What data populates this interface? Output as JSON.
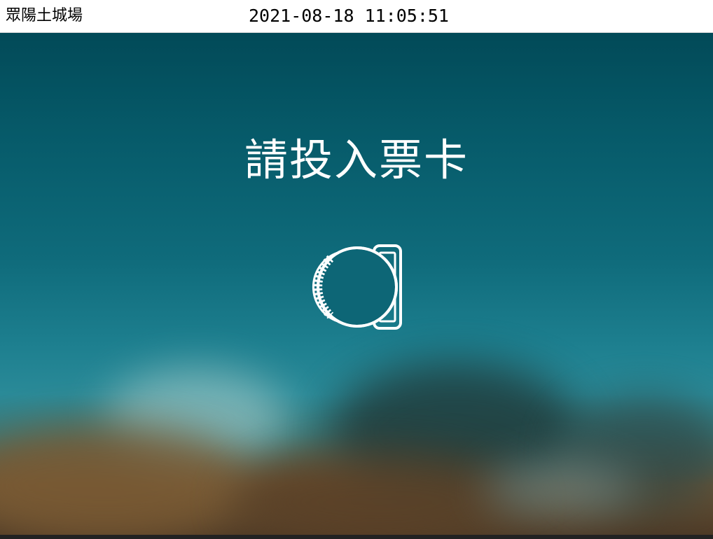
{
  "header": {
    "station_name": "眾陽土城場",
    "datetime": "2021-08-18 11:05:51"
  },
  "main": {
    "prompt": "請投入票卡",
    "icon": "ticket-card-insert-icon"
  },
  "colors": {
    "header_bg": "#ffffff",
    "text_on_header": "#000000",
    "screen_top": "#024a58",
    "screen_mid": "#1d7f8f",
    "screen_bottom": "#4e3a26",
    "prompt_text": "#ffffff"
  }
}
